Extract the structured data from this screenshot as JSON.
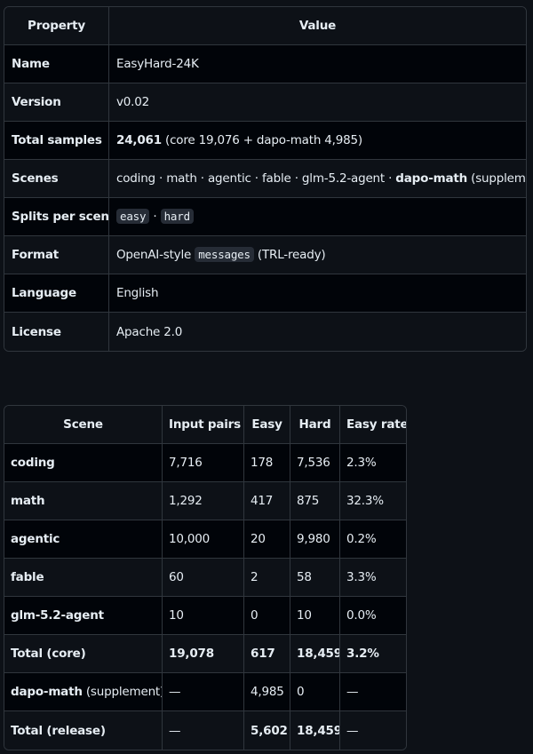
{
  "props": {
    "headers": [
      "Property",
      "Value"
    ],
    "rows": [
      {
        "key": "Name",
        "value": "EasyHard-24K"
      },
      {
        "key": "Version",
        "value": "v0.02"
      },
      {
        "key": "Total samples",
        "bold": "24,061",
        "rest": " (core 19,076 + dapo-math 4,985)"
      },
      {
        "key": "Scenes",
        "scenes": "coding · math · agentic · fable · glm-5.2-agent · ",
        "supp_bold": "dapo-math",
        "supp_rest": " (supplement)"
      },
      {
        "key": "Splits per scene",
        "code1": "easy",
        "sep": " · ",
        "code2": "hard"
      },
      {
        "key": "Format",
        "pre": "OpenAI-style ",
        "code": "messages",
        "post": " (TRL-ready)"
      },
      {
        "key": "Language",
        "value": "English"
      },
      {
        "key": "License",
        "value": "Apache 2.0"
      }
    ]
  },
  "scenes": {
    "headers": [
      "Scene",
      "Input pairs",
      "Easy",
      "Hard",
      "Easy rate"
    ],
    "rows": [
      {
        "scene": "coding",
        "input": "7,716",
        "easy": "178",
        "hard": "7,536",
        "rate": "2.3%"
      },
      {
        "scene": "math",
        "input": "1,292",
        "easy": "417",
        "hard": "875",
        "rate": "32.3%"
      },
      {
        "scene": "agentic",
        "input": "10,000",
        "easy": "20",
        "hard": "9,980",
        "rate": "0.2%"
      },
      {
        "scene": "fable",
        "input": "60",
        "easy": "2",
        "hard": "58",
        "rate": "3.3%"
      },
      {
        "scene": "glm-5.2-agent",
        "input": "10",
        "easy": "0",
        "hard": "10",
        "rate": "0.0%"
      },
      {
        "scene": "Total (core)",
        "input": "19,078",
        "easy": "617",
        "hard": "18,459",
        "rate": "3.2%"
      },
      {
        "scene": "dapo-math",
        "scene_note": " (supplement)",
        "input": "—",
        "easy": "4,985",
        "hard": "0",
        "rate": "—"
      },
      {
        "scene": "Total (release)",
        "input": "—",
        "easy": "5,602",
        "hard": "18,459",
        "rate": "—"
      }
    ]
  }
}
